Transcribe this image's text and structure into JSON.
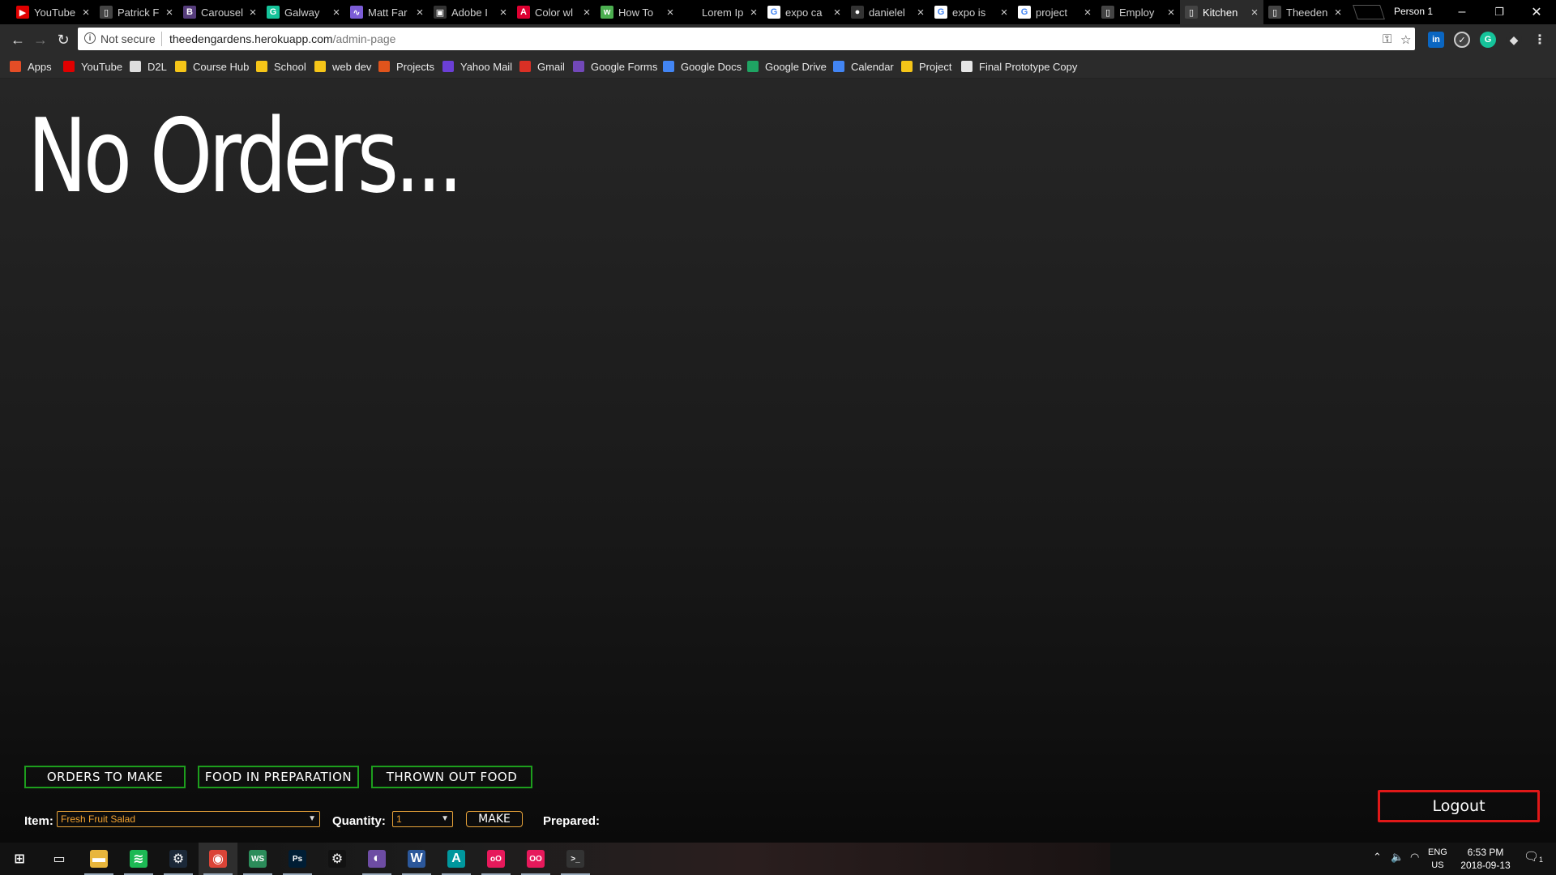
{
  "browser": {
    "tabs": [
      {
        "title": "YouTube",
        "favicon": "youtube-icon",
        "color": "#e00000",
        "glyph": "▶"
      },
      {
        "title": "Patrick F",
        "favicon": "document-icon",
        "color": "#444444",
        "glyph": "▯"
      },
      {
        "title": "Carousel",
        "favicon": "bootstrap-icon",
        "color": "#563d7c",
        "glyph": "B"
      },
      {
        "title": "Galway",
        "favicon": "grammarly-icon",
        "color": "#15c39a",
        "glyph": "G"
      },
      {
        "title": "Matt Far",
        "favicon": "chart-icon",
        "color": "#7b5cd6",
        "glyph": "∿"
      },
      {
        "title": "Adobe I",
        "favicon": "adobe-icon",
        "color": "#333333",
        "glyph": "▣"
      },
      {
        "title": "Color wl",
        "favicon": "angular-icon",
        "color": "#dd0031",
        "glyph": "A"
      },
      {
        "title": "How To",
        "favicon": "w3schools-icon",
        "color": "#4caf50",
        "glyph": "w"
      },
      {
        "title": "Lorem Ip",
        "favicon": "blank-icon",
        "color": "#000000",
        "glyph": ""
      },
      {
        "title": "expo ca",
        "favicon": "google-icon",
        "color": "#ffffff",
        "glyph": "G"
      },
      {
        "title": "danielel",
        "favicon": "github-icon",
        "color": "#333333",
        "glyph": "●"
      },
      {
        "title": "expo is",
        "favicon": "google-icon",
        "color": "#ffffff",
        "glyph": "G"
      },
      {
        "title": "project",
        "favicon": "google-icon",
        "color": "#ffffff",
        "glyph": "G"
      },
      {
        "title": "Employ",
        "favicon": "document-icon",
        "color": "#444444",
        "glyph": "▯"
      },
      {
        "title": "Kitchen",
        "favicon": "document-icon",
        "color": "#444444",
        "glyph": "▯",
        "active": true
      },
      {
        "title": "Theeden",
        "favicon": "document-icon",
        "color": "#444444",
        "glyph": "▯"
      }
    ],
    "profile": "Person 1",
    "window_controls": {
      "minimize": "–",
      "restore": "❐",
      "close": "✕"
    },
    "address": {
      "security": "Not secure",
      "host": "theedengardens.herokuapp.com",
      "path": "/admin-page"
    },
    "nav": {
      "back": "←",
      "forward": "→",
      "reload": "↻"
    },
    "bookmarks": [
      {
        "label": "Apps",
        "icon": "apps-grid-icon",
        "color": "#e44d26"
      },
      {
        "label": "YouTube",
        "icon": "youtube-icon",
        "color": "#e00000"
      },
      {
        "label": "D2L",
        "icon": "d2l-icon",
        "color": "#dddddd"
      },
      {
        "label": "Course Hub",
        "icon": "folder-icon",
        "color": "#f5c518"
      },
      {
        "label": "School",
        "icon": "folder-icon",
        "color": "#f5c518"
      },
      {
        "label": "web dev",
        "icon": "folder-icon",
        "color": "#f5c518"
      },
      {
        "label": "Projects",
        "icon": "fire-icon",
        "color": "#e0541c"
      },
      {
        "label": "Yahoo Mail",
        "icon": "mail-icon",
        "color": "#6b3fd6"
      },
      {
        "label": "Gmail",
        "icon": "gmail-icon",
        "color": "#d93025"
      },
      {
        "label": "Google Forms",
        "icon": "forms-icon",
        "color": "#7248b9"
      },
      {
        "label": "Google Docs",
        "icon": "docs-icon",
        "color": "#4285f4"
      },
      {
        "label": "Google Drive",
        "icon": "drive-icon",
        "color": "#1fa463"
      },
      {
        "label": "Calendar",
        "icon": "calendar-icon",
        "color": "#4285f4"
      },
      {
        "label": "Project",
        "icon": "folder-icon",
        "color": "#f5c518"
      },
      {
        "label": "Final Prototype Copy",
        "icon": "sheet-icon",
        "color": "#e6e6e6"
      }
    ]
  },
  "page": {
    "heading": "No Orders...",
    "tabs": [
      "ORDERS TO MAKE",
      "FOOD IN PREPARATION",
      "THROWN OUT FOOD"
    ],
    "form": {
      "item_label": "Item:",
      "item_value": "Fresh Fruit Salad",
      "quantity_label": "Quantity:",
      "quantity_value": "1",
      "make_label": "MAKE",
      "prepared_label": "Prepared:"
    },
    "logout_label": "Logout",
    "colors": {
      "tab_border": "#1d9e1d",
      "logout_border": "#e01818",
      "field_border": "#e8a33a"
    }
  },
  "taskbar": {
    "apps": [
      {
        "name": "start-icon",
        "glyph": "⊞",
        "color": "#121212"
      },
      {
        "name": "task-view-icon",
        "glyph": "▭",
        "color": "#121212"
      },
      {
        "name": "file-explorer-icon",
        "glyph": "▬",
        "color": "#e8b63c"
      },
      {
        "name": "spotify-icon",
        "glyph": "≋",
        "color": "#1db954"
      },
      {
        "name": "steam-icon",
        "glyph": "⚙",
        "color": "#1b2838"
      },
      {
        "name": "chrome-icon",
        "glyph": "◉",
        "color": "#db4437",
        "active": true
      },
      {
        "name": "webstorm-icon",
        "glyph": "WS",
        "color": "#2b8c5a"
      },
      {
        "name": "photoshop-icon",
        "glyph": "Ps",
        "color": "#001d34"
      },
      {
        "name": "settings-icon",
        "glyph": "⚙",
        "color": "#121212"
      },
      {
        "name": "eclipse-icon",
        "glyph": "◐",
        "color": "#6d4ca3"
      },
      {
        "name": "word-icon",
        "glyph": "W",
        "color": "#2b579a"
      },
      {
        "name": "arduino-icon",
        "glyph": "A",
        "color": "#00979d"
      },
      {
        "name": "origin-icon",
        "glyph": "oO",
        "color": "#e6195b"
      },
      {
        "name": "git-icon",
        "glyph": "OO",
        "color": "#e6195b"
      },
      {
        "name": "terminal-icon",
        "glyph": ">_",
        "color": "#333333"
      }
    ],
    "language": "ENG",
    "region": "US",
    "time": "6:53 PM",
    "date": "2018-09-13",
    "notification_count": "1"
  }
}
